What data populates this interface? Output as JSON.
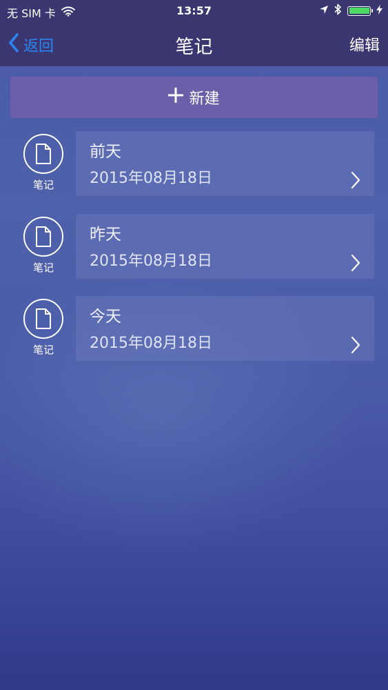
{
  "status_bar": {
    "carrier": "无 SIM 卡",
    "time": "13:57",
    "battery_level": 1.0,
    "battery_color": "#4cd964"
  },
  "nav": {
    "back_label": "返回",
    "title": "笔记",
    "edit_label": "编辑",
    "back_color": "#2d86f0"
  },
  "new_button": {
    "label": "新建"
  },
  "notes": [
    {
      "title": "前天",
      "date": "2015年08月18日",
      "icon_label": "笔记"
    },
    {
      "title": "昨天",
      "date": "2015年08月18日",
      "icon_label": "笔记"
    },
    {
      "title": "今天",
      "date": "2015年08月18日",
      "icon_label": "笔记"
    }
  ],
  "icons": {
    "wifi": "wifi-icon",
    "location": "location-arrow-icon",
    "bluetooth": "bluetooth-icon",
    "battery": "battery-icon",
    "charging": "charging-bolt-icon",
    "back": "chevron-left-icon",
    "plus": "plus-icon",
    "note": "document-icon",
    "row_arrow": "chevron-right-icon"
  }
}
